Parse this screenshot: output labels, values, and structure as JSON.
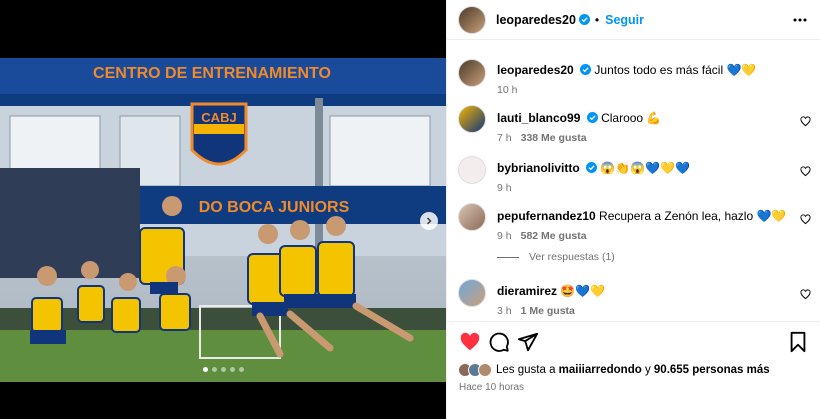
{
  "post": {
    "author": "leoparedes20",
    "follow_label": "Seguir",
    "separator": "•",
    "caption": "Juntos todo es más fácil 💙💛",
    "caption_time": "10 h"
  },
  "image": {
    "sign_top": "CENTRO DE ENTRENAMIENTO",
    "crest": "CABJ",
    "sign_bottom": "DO BOCA JUNIORS",
    "carousel_dots": 5,
    "carousel_active": 0
  },
  "comments": [
    {
      "user": "lauti_blanco99",
      "verified": true,
      "text": "Clarooo 💪",
      "time": "7 h",
      "likes": "338 Me gusta"
    },
    {
      "user": "bybrianolivitto",
      "verified": true,
      "text": "😱👏😱💙💛💙",
      "time": "9 h",
      "likes": ""
    },
    {
      "user": "pepufernandez10",
      "verified": false,
      "text": "Recupera a Zenón lea, hazlo 💙💛",
      "time": "9 h",
      "likes": "582 Me gusta"
    },
    {
      "user": "dieramirez",
      "verified": false,
      "text": "🤩💙💛",
      "time": "3 h",
      "likes": "1 Me gusta"
    }
  ],
  "replies_label": "Ver respuestas (1)",
  "footer": {
    "liked_prefix": "Les gusta a",
    "liked_user": "maiiiarredondo",
    "liked_joiner": "y",
    "liked_count": "90.655 personas más",
    "post_time": "Hace 10 horas"
  },
  "colors": {
    "accent": "#0095f6",
    "like_red": "#ff3040",
    "boca_blue": "#103f8c",
    "boca_yellow": "#f5b400",
    "sign_orange": "#f08a2a"
  },
  "icons": [
    "verified-icon",
    "more-icon",
    "heart-icon",
    "comment-icon",
    "share-icon",
    "bookmark-icon",
    "chevron-right-icon"
  ]
}
